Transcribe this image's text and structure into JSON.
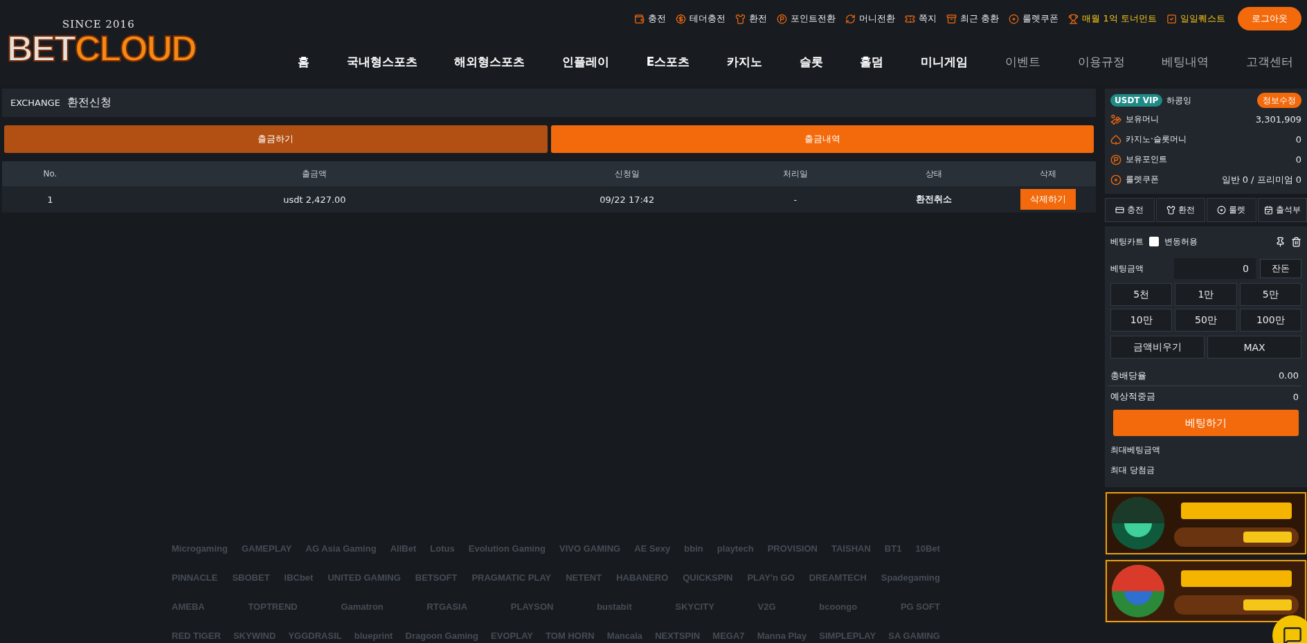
{
  "logo": {
    "tagline": "SINCE 2016",
    "name_light": "BET",
    "name_orange": "CLOUD"
  },
  "top_links": [
    {
      "label": "충전",
      "kind": "normal"
    },
    {
      "label": "테더충전",
      "kind": "normal"
    },
    {
      "label": "환전",
      "kind": "normal"
    },
    {
      "label": "포인트전환",
      "kind": "normal"
    },
    {
      "label": "머니전환",
      "kind": "normal"
    },
    {
      "label": "쪽지",
      "kind": "normal"
    },
    {
      "label": "최근 충환",
      "kind": "normal"
    },
    {
      "label": "룰렛쿠폰",
      "kind": "normal"
    },
    {
      "label": "매월 1억 토너먼트",
      "kind": "highlight"
    },
    {
      "label": "일일퀘스트",
      "kind": "highlight"
    }
  ],
  "logout_button": "로그아웃",
  "nav": [
    {
      "label": "홈",
      "kind": "primary"
    },
    {
      "label": "국내형스포츠",
      "kind": "primary"
    },
    {
      "label": "해외형스포츠",
      "kind": "primary"
    },
    {
      "label": "인플레이",
      "kind": "primary"
    },
    {
      "label": "E스포츠",
      "kind": "primary"
    },
    {
      "label": "카지노",
      "kind": "primary"
    },
    {
      "label": "슬롯",
      "kind": "primary"
    },
    {
      "label": "홀덤",
      "kind": "primary"
    },
    {
      "label": "미니게임",
      "kind": "primary"
    },
    {
      "label": "이벤트",
      "kind": "secondary"
    },
    {
      "label": "이용규정",
      "kind": "secondary"
    },
    {
      "label": "베팅내역",
      "kind": "secondary"
    },
    {
      "label": "고객센터",
      "kind": "secondary"
    }
  ],
  "exchange": {
    "prefix": "EXCHANGE",
    "title": "환전신청",
    "tabs": [
      {
        "label": "출금하기",
        "selected": false
      },
      {
        "label": "출금내역",
        "selected": true
      }
    ],
    "table": {
      "columns": [
        "No.",
        "출금액",
        "신청일",
        "처리일",
        "상태",
        "삭제"
      ],
      "rows": [
        {
          "no": "1",
          "amount": "usdt 2,427.00",
          "requested": "09/22 17:42",
          "processed": "-",
          "status": "환전취소",
          "action": "삭제하기"
        }
      ]
    }
  },
  "providers": [
    [
      "Microgaming",
      "GAMEPLAY",
      "AG Asia Gaming",
      "AllBet",
      "Lotus",
      "Evolution Gaming",
      "VIVO GAMING",
      "AE Sexy",
      "bbin",
      "playtech",
      "PROVISION",
      "TAISHAN",
      "BT1",
      "10Bet"
    ],
    [
      "PINNACLE",
      "SBOBET",
      "IBCbet",
      "UNITED GAMING",
      "BETSOFT",
      "PRAGMATIC PLAY",
      "NETENT",
      "HABANERO",
      "QUICKSPIN",
      "PLAY'n GO",
      "DREAMTECH",
      "Spadegaming"
    ],
    [
      "AMEBA",
      "TOPTREND",
      "Gamatron",
      "RTGASIA",
      "PLAYSON",
      "bustabit",
      "SKYCITY",
      "V2G",
      "bcoongo",
      "PG SOFT"
    ],
    [
      "RED TIGER",
      "SKYWIND",
      "YGGDRASIL",
      "blueprint",
      "Dragoon Gaming",
      "EVOPLAY",
      "TOM HORN",
      "Mancala",
      "NEXTSPIN",
      "MEGA7",
      "Manna Play",
      "SIMPLEPLAY",
      "SA GAMING"
    ]
  ],
  "sidebar": {
    "user": {
      "badge": "USDT VIP",
      "name": "하콩잉",
      "edit_button": "정보수정"
    },
    "balances": [
      {
        "label": "보유머니",
        "value": "3,301,909"
      },
      {
        "label": "카지노·슬롯머니",
        "value": "0"
      },
      {
        "label": "보유포인트",
        "value": "0"
      },
      {
        "label": "룰렛쿠폰",
        "value": "일반 0 / 프리미엄 0"
      }
    ],
    "quick_tabs": [
      "충전",
      "환전",
      "룰렛",
      "출석부"
    ],
    "bet_cart": {
      "title": "베팅카트",
      "allow_change": {
        "label": "변동허용",
        "checked": false
      },
      "amount_label": "베팅금액",
      "amount_value": "0",
      "change_button": "잔돈",
      "chips": [
        "5천",
        "1만",
        "5만",
        "10만",
        "50만",
        "100만"
      ],
      "clear_button": "금액비우기",
      "max_button": "MAX",
      "odds": {
        "label": "총배당율",
        "value": "0.00"
      },
      "expected": {
        "label": "예상적중금",
        "value": "0"
      },
      "submit_button": "베팅하기",
      "limits": [
        "최대베팅금액",
        "최대 당첨금"
      ]
    }
  }
}
